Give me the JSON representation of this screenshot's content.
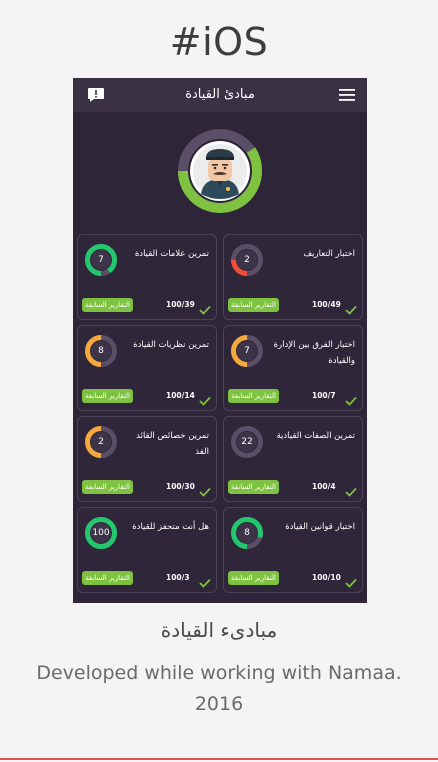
{
  "page": {
    "heading": "#iOS",
    "caption_title": "مبادىء القيادة",
    "caption_description": "Developed while working with Namaa. 2016",
    "accent_line_color": "#d9534f"
  },
  "app": {
    "title": "مبادئ القيادة",
    "topbar_icons": [
      "feedback-icon",
      "menu-icon"
    ],
    "avatar_ring_colors": {
      "progress": "#7fc241",
      "track": "#5a4f66"
    }
  },
  "cards": [
    {
      "title": "اختبار التعاريف",
      "ring_value": "2",
      "progress": 0.25,
      "ring_color": "#f04e37",
      "score": "100/49",
      "reports_label": "التقارير السابقة"
    },
    {
      "title": "تمرين علامات القيادة",
      "ring_value": "7",
      "progress": 0.9,
      "ring_color": "#22c76e",
      "score": "100/39",
      "reports_label": "التقارير السابقة"
    },
    {
      "title": "اختبار الفرق بين الإدارة والقيادة",
      "ring_value": "7",
      "progress": 0.5,
      "ring_color": "#f5a83b",
      "score": "100/7",
      "reports_label": "التقارير السابقة"
    },
    {
      "title": "تمرين نظريات القيادة",
      "ring_value": "8",
      "progress": 0.5,
      "ring_color": "#f5a83b",
      "score": "100/14",
      "reports_label": "التقارير السابقة"
    },
    {
      "title": "تمرين الصفات القيادية",
      "ring_value": "22",
      "progress": 0.0,
      "ring_color": "#f04e37",
      "score": "100/4",
      "reports_label": "التقارير السابقة"
    },
    {
      "title": "تمرين خصائص القائد الفذ",
      "ring_value": "2",
      "progress": 0.5,
      "ring_color": "#f5a83b",
      "score": "100/30",
      "reports_label": "التقارير السابقة"
    },
    {
      "title": "اختبار قوانين القيادة",
      "ring_value": "8",
      "progress": 0.8,
      "ring_color": "#22c76e",
      "score": "100/10",
      "reports_label": "التقارير السابقة"
    },
    {
      "title": "هل أنت متحفز للقيادة",
      "ring_value": "100",
      "progress": 1.0,
      "ring_color": "#22c76e",
      "score": "100/3",
      "reports_label": "التقارير السابقة"
    }
  ]
}
